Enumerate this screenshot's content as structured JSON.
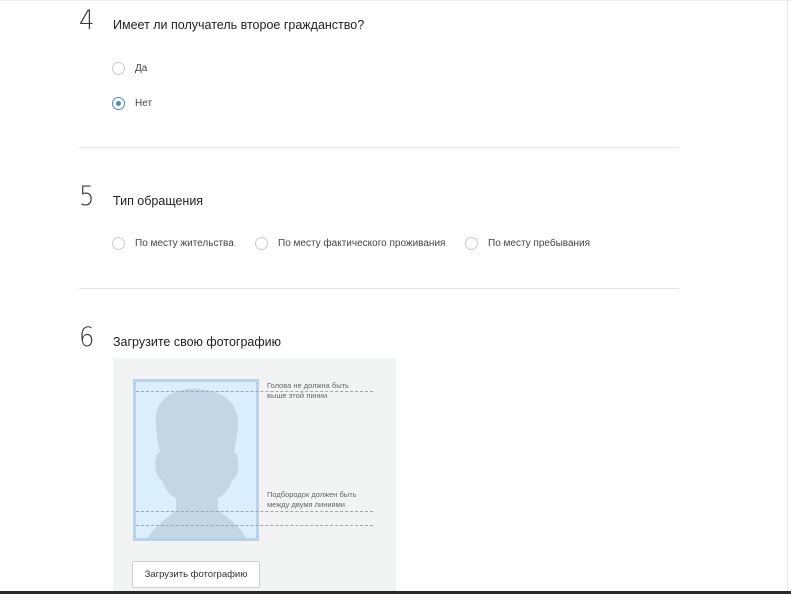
{
  "sections": [
    {
      "number": "4",
      "question": "Имеет ли получатель второе гражданство?",
      "options": [
        {
          "label": "Да",
          "selected": false
        },
        {
          "label": "Нет",
          "selected": true
        }
      ]
    },
    {
      "number": "5",
      "question": "Тип обращения",
      "options": [
        {
          "label": "По месту жительства",
          "selected": false
        },
        {
          "label": "По месту фактического проживания",
          "selected": false
        },
        {
          "label": "По месту пребывания",
          "selected": false
        }
      ]
    },
    {
      "number": "6",
      "question": "Загрузите свою фотографию",
      "photo_guide": {
        "head_line_text": [
          "Голова не должна быть",
          "выше этой линии"
        ],
        "chin_line_text": [
          "Подбородок должен быть",
          "между двумя линиями"
        ]
      },
      "upload_button_label": "Загрузить фотографию"
    }
  ],
  "colors": {
    "accent": "#4a8fc4",
    "frame_border": "#b7d3ec",
    "frame_fill": "#dbeefb",
    "silhouette": "#c4d5e3",
    "panel_bg": "#f2f3f3"
  },
  "icons": {
    "silhouette": "person-silhouette-icon"
  }
}
